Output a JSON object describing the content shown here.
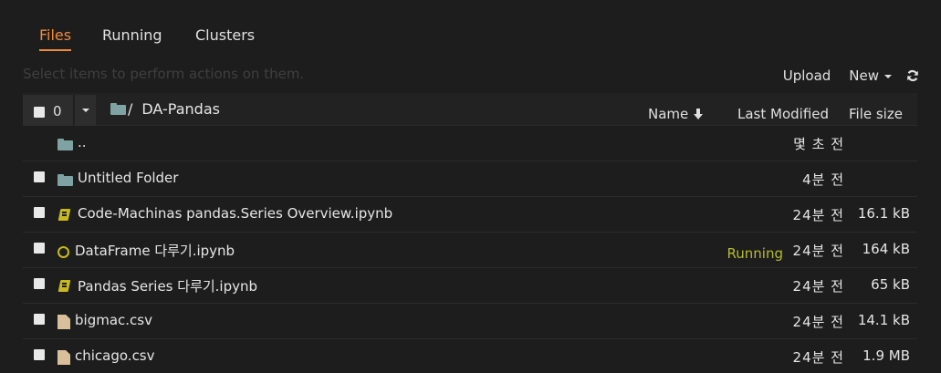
{
  "tabs": [
    {
      "label": "Files",
      "active": true
    },
    {
      "label": "Running",
      "active": false
    },
    {
      "label": "Clusters",
      "active": false
    }
  ],
  "hint": "Select items to perform actions on them.",
  "toolbar": {
    "upload_label": "Upload",
    "new_label": "New",
    "refresh_icon": "refresh-icon"
  },
  "list_header": {
    "selected_count": "0",
    "breadcrumb_slash": "/",
    "breadcrumb_folder": "DA-Pandas",
    "col_name": "Name",
    "col_last_modified": "Last Modified",
    "col_file_size": "File size"
  },
  "rows": [
    {
      "type": "parent",
      "name": "..",
      "modified": "몇 초 전",
      "size": "",
      "running": ""
    },
    {
      "type": "folder",
      "name": "Untitled Folder",
      "modified": "4분 전",
      "size": "",
      "running": ""
    },
    {
      "type": "notebook",
      "name": "Code-Machinas pandas.Series Overview.ipynb",
      "modified": "24분 전",
      "size": "16.1 kB",
      "running": ""
    },
    {
      "type": "notebook-running",
      "name": "DataFrame 다루기.ipynb",
      "modified": "24분 전",
      "size": "164 kB",
      "running": "Running"
    },
    {
      "type": "notebook",
      "name": "Pandas Series 다루기.ipynb",
      "modified": "24분 전",
      "size": "65 kB",
      "running": ""
    },
    {
      "type": "file",
      "name": "bigmac.csv",
      "modified": "24분 전",
      "size": "14.1 kB",
      "running": ""
    },
    {
      "type": "file",
      "name": "chicago.csv",
      "modified": "24분 전",
      "size": "1.9 MB",
      "running": ""
    }
  ],
  "colors": {
    "accent": "#f08a3c",
    "running": "#b7bb2f",
    "folder": "#7fa3a3",
    "notebook": "#c8b91c",
    "file": "#d9c09a"
  }
}
